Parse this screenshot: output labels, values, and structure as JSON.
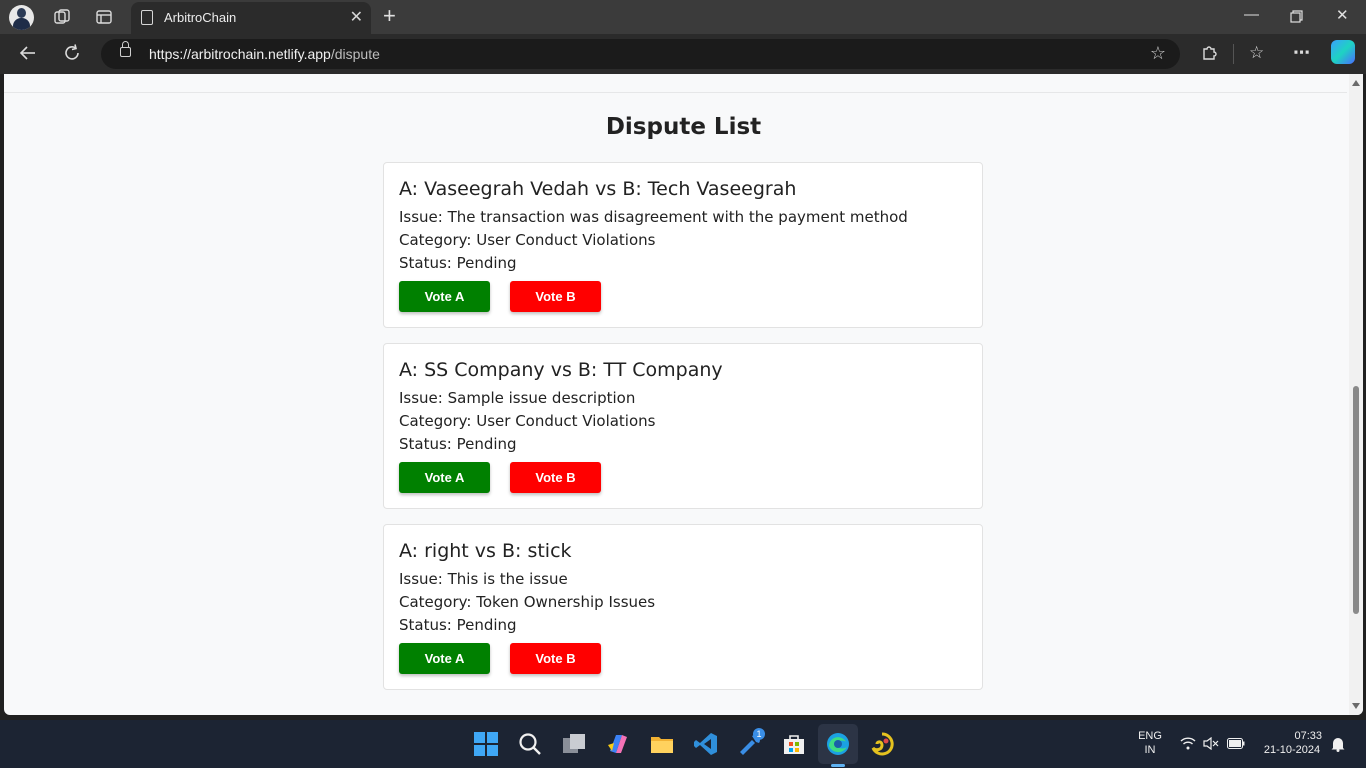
{
  "browser": {
    "tab_title": "ArbitroChain",
    "url_domain": "https://arbitrochain.netlify.app",
    "url_path": "/dispute"
  },
  "page": {
    "title": "Dispute List"
  },
  "disputes": [
    {
      "parties": "A: Vaseegrah Vedah vs B: Tech Vaseegrah",
      "issue": "Issue: The transaction was disagreement with the payment method",
      "category": "Category: User Conduct Violations",
      "status": "Status: Pending",
      "vote_a": "Vote A",
      "vote_b": "Vote B"
    },
    {
      "parties": "A: SS Company vs B: TT Company",
      "issue": "Issue: Sample issue description",
      "category": "Category: User Conduct Violations",
      "status": "Status: Pending",
      "vote_a": "Vote A",
      "vote_b": "Vote B"
    },
    {
      "parties": "A: right vs B: stick",
      "issue": "Issue: This is the issue",
      "category": "Category: Token Ownership Issues",
      "status": "Status: Pending",
      "vote_a": "Vote A",
      "vote_b": "Vote B"
    }
  ],
  "colors": {
    "vote_a": "#008000",
    "vote_b": "#ff0000",
    "page_bg": "#f8f9fa"
  },
  "taskbar": {
    "lang_top": "ENG",
    "lang_bottom": "IN",
    "time": "07:33",
    "date": "21-10-2024",
    "badge": "1"
  }
}
